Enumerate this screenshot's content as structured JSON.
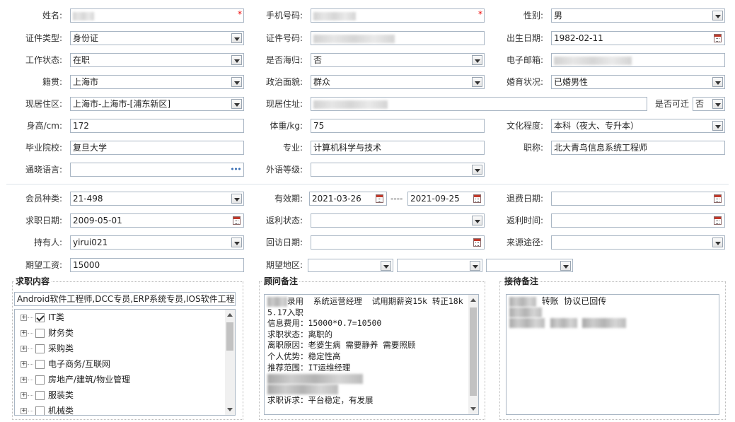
{
  "basic": {
    "name": {
      "label": "姓名:",
      "value": ""
    },
    "phone": {
      "label": "手机号码:",
      "value": ""
    },
    "gender": {
      "label": "性别:",
      "value": "男"
    },
    "id_type": {
      "label": "证件类型:",
      "value": "身份证"
    },
    "id_number": {
      "label": "证件号码:",
      "value": ""
    },
    "birth_date": {
      "label": "出生日期:",
      "value": "1982-02-11"
    },
    "work_status": {
      "label": "工作状态:",
      "value": "在职"
    },
    "returnee": {
      "label": "是否海归:",
      "value": "否"
    },
    "email": {
      "label": "电子邮箱:",
      "value": ""
    },
    "native_place": {
      "label": "籍贯:",
      "value": "上海市"
    },
    "political_status": {
      "label": "政治面貌:",
      "value": "群众"
    },
    "marital_status": {
      "label": "婚育状况:",
      "value": "已婚男性"
    },
    "residence_area": {
      "label": "现居住区:",
      "value": "上海市-上海市-[浦东新区]"
    },
    "residence_address": {
      "label": "现居住址:",
      "value": ""
    },
    "relocatable": {
      "label": "是否可迁",
      "value": "否"
    },
    "height": {
      "label": "身高/cm:",
      "value": "172"
    },
    "weight": {
      "label": "体重/kg:",
      "value": "75"
    },
    "education": {
      "label": "文化程度:",
      "value": "本科（夜大、专升本）"
    },
    "school": {
      "label": "毕业院校:",
      "value": "复旦大学"
    },
    "major": {
      "label": "专业:",
      "value": "计算机科学与技术"
    },
    "title": {
      "label": "职称:",
      "value": "北大青鸟信息系统工程师"
    },
    "languages": {
      "label": "通晓语言:",
      "value": ""
    },
    "foreign_level": {
      "label": "外语等级:",
      "value": ""
    }
  },
  "membership": {
    "member_type": {
      "label": "会员种类:",
      "value": "21-498"
    },
    "valid_period": {
      "label": "有效期:",
      "start": "2021-03-26",
      "separator": "----",
      "end": "2021-09-25"
    },
    "refund_date": {
      "label": "退费日期:",
      "value": ""
    },
    "job_seek_date": {
      "label": "求职日期:",
      "value": "2009-05-01"
    },
    "rebate_status": {
      "label": "返利状态:",
      "value": ""
    },
    "rebate_time": {
      "label": "返利时间:",
      "value": ""
    },
    "holder": {
      "label": "持有人:",
      "value": "yirui021"
    },
    "revisit_date": {
      "label": "回访日期:",
      "value": ""
    },
    "source": {
      "label": "来源途径:",
      "value": ""
    },
    "expected_salary": {
      "label": "期望工资:",
      "value": "15000"
    },
    "expected_region": {
      "label": "期望地区:",
      "value1": "",
      "value2": "",
      "value3": ""
    }
  },
  "job_content": {
    "legend": "求职内容",
    "summary": "Android软件工程师,DCC专员,ERP系统专员,IOS软件工程",
    "categories": [
      {
        "label": "IT类",
        "checked": true
      },
      {
        "label": "财务类",
        "checked": false
      },
      {
        "label": "采购类",
        "checked": false
      },
      {
        "label": "电子商务/互联网",
        "checked": false
      },
      {
        "label": "房地产/建筑/物业管理",
        "checked": false
      },
      {
        "label": "服装类",
        "checked": false
      },
      {
        "label": "机械类",
        "checked": false
      }
    ],
    "expand_symbol": "+"
  },
  "advisor_notes": {
    "legend": "顾问备注",
    "lines": [
      "录用  系统运营经理  试用期薪资15k 转正18k",
      "5.17入职",
      "信息费用：15000*0.7=10500",
      "",
      "求职状态：离职的",
      "离职原因：老婆生病 需要静养 需要照顾",
      "个人优势：稳定性高",
      "推荐范围：IT运维经理",
      "",
      "",
      "求职诉求：平台稳定，有发展"
    ]
  },
  "reception_notes": {
    "legend": "接待备注",
    "line1": "转账  协议已回传"
  },
  "colors": {
    "border": "#a9b6c4",
    "required": "#ee0000",
    "separator": "#dde3ea"
  },
  "icons": {
    "dropdown": "chevron-down-icon",
    "calendar": "calendar-icon",
    "more": "more-dots-icon",
    "expand": "expand-plus-icon"
  }
}
